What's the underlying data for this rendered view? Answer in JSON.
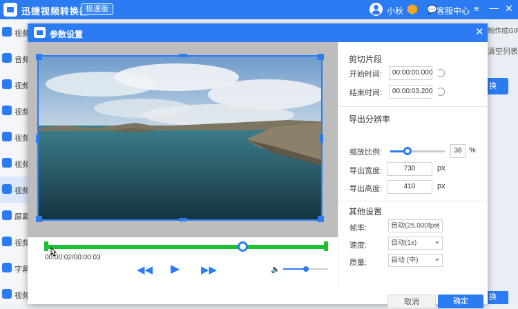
{
  "app": {
    "title": "迅捷视频转换器",
    "badge": "极速版",
    "user": "小秋",
    "service": "客服中心"
  },
  "icons": {
    "menu": "≡",
    "minimize": "—",
    "close": "✕",
    "service": "💬"
  },
  "sidebar": {
    "items": [
      {
        "label": "视频",
        "icon": "video-convert-icon"
      },
      {
        "label": "音频",
        "icon": "audio-icon"
      },
      {
        "label": "视频",
        "icon": "video-compress-icon"
      },
      {
        "label": "视频",
        "icon": "video-split-icon"
      },
      {
        "label": "视频",
        "icon": "video-merge-icon"
      },
      {
        "label": "视频",
        "icon": "video-crop-icon"
      },
      {
        "label": "视频",
        "icon": "video-edit-icon",
        "active": true
      },
      {
        "label": "屏幕",
        "icon": "screen-record-icon"
      },
      {
        "label": "视频",
        "icon": "video-speed-icon"
      },
      {
        "label": "字幕",
        "icon": "subtitle-icon"
      },
      {
        "label": "视频",
        "icon": "video-more-icon"
      }
    ]
  },
  "background": {
    "gif_link": "制作成GIF",
    "clear_list": "清空列表",
    "convert_button": "换",
    "convert_button2": "换"
  },
  "dialog": {
    "title": "参数设置",
    "close_icon": "✕",
    "player": {
      "time": "00:00:02/00:00:03",
      "prev": "◀◀",
      "play": "▶",
      "next": "▶▶",
      "volume_icon": "🔈",
      "progress_fraction": 0.7,
      "volume_fraction": 0.5
    },
    "clip": {
      "title": "剪切片段",
      "start_label": "开始时间:",
      "start_value": "00:00:00.000",
      "end_label": "结束时间:",
      "end_value": "00:00:03.200"
    },
    "resolution": {
      "title": "导出分辨率",
      "scale_label": "缩放比例:",
      "scale_value": "38",
      "scale_unit": "%",
      "width_label": "导出宽度:",
      "width_value": "730",
      "height_label": "导出高度:",
      "height_value": "410",
      "unit": "px"
    },
    "other": {
      "title": "其他设置",
      "fps_label": "帧率:",
      "fps_value": "自动(25.000fps)",
      "speed_label": "速度:",
      "speed_value": "自动(1x)",
      "quality_label": "质量:",
      "quality_value": "自动 (中)"
    },
    "buttons": {
      "cancel": "取消",
      "ok": "确定"
    }
  }
}
